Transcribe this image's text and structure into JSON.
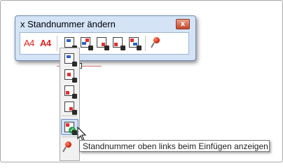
{
  "window": {
    "title": "x Standnummer ändern",
    "close_glyph": "x"
  },
  "toolbar": {
    "buttons": [
      {
        "icon": "font-a4-icon",
        "label": "A4"
      },
      {
        "icon": "font-a4-bold-icon",
        "label": "A4"
      },
      {
        "icon": "number-position-dropdown-icon"
      },
      {
        "icon": "number-top-right-icon"
      },
      {
        "icon": "number-bottom-right-icon"
      },
      {
        "icon": "number-bottom-left-icon"
      },
      {
        "icon": "number-insert-icon"
      },
      {
        "icon": "pin-icon"
      }
    ]
  },
  "dropdown": {
    "items": [
      {
        "icon": "position-top-left-icon"
      },
      {
        "icon": "position-center-icon"
      },
      {
        "icon": "position-bottom-left-icon"
      },
      {
        "icon": "position-bottom-right-icon"
      },
      {
        "icon": "show-top-left-on-insert-icon",
        "selected": true
      },
      {
        "icon": "pin-icon"
      }
    ]
  },
  "tooltip": {
    "text": "Standnummer oben links beim Einfügen anzeigen"
  },
  "colors": {
    "accent_red": "#e02020",
    "window_bg": "#d4e3f6",
    "check_green": "#28a04c"
  }
}
